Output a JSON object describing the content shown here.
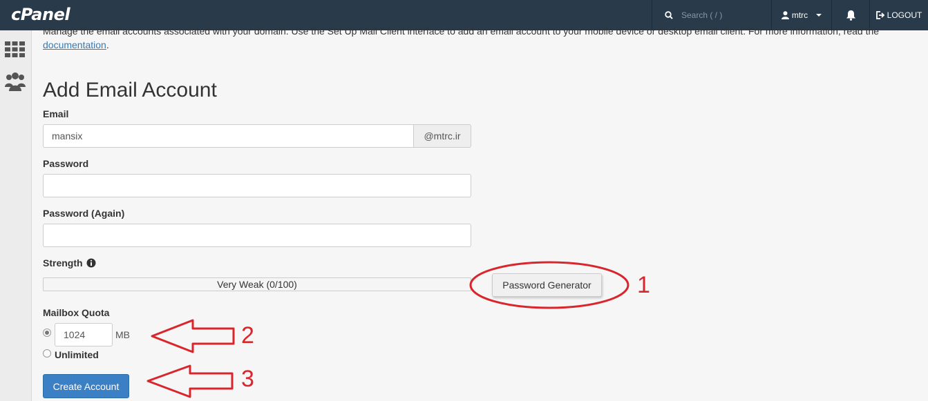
{
  "header": {
    "logo": "cPanel",
    "search_placeholder": "Search ( / )",
    "username": "mtrc",
    "logout_label": "LOGOUT"
  },
  "intro": {
    "text": "Manage the email accounts associated with your domain. Use the Set Up Mail Client interface to add an email account to your mobile device or desktop email client. For more information, read the",
    "link": "documentation",
    "end": "."
  },
  "form": {
    "title": "Add Email Account",
    "email_label": "Email",
    "email_value": "mansix",
    "domain": "@mtrc.ir",
    "password_label": "Password",
    "password_again_label": "Password (Again)",
    "strength_label": "Strength",
    "strength_value": "Very Weak (0/100)",
    "password_generator_label": "Password Generator",
    "quota_label": "Mailbox Quota",
    "quota_value": "1024",
    "quota_unit": "MB",
    "unlimited_label": "Unlimited",
    "create_label": "Create Account"
  },
  "annotations": {
    "marker1": "1",
    "marker2": "2",
    "marker3": "3"
  },
  "colors": {
    "topbar": "#293a4a",
    "primary_button": "#3b7fc4",
    "annotation": "#d9262c"
  },
  "icons": [
    "search-icon",
    "user-icon",
    "bell-icon",
    "logout-icon",
    "apps-grid-icon",
    "users-group-icon",
    "info-icon"
  ]
}
